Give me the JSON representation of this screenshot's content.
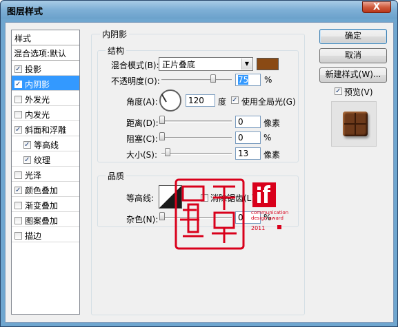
{
  "window": {
    "title": "图层样式",
    "close": "X"
  },
  "stylelist": {
    "header": "样式",
    "blend": "混合选项:默认",
    "items": [
      {
        "label": "投影",
        "checked": true,
        "sub": false,
        "selected": false
      },
      {
        "label": "内阴影",
        "checked": true,
        "sub": false,
        "selected": true
      },
      {
        "label": "外发光",
        "checked": false,
        "sub": false,
        "selected": false
      },
      {
        "label": "内发光",
        "checked": false,
        "sub": false,
        "selected": false
      },
      {
        "label": "斜面和浮雕",
        "checked": true,
        "sub": false,
        "selected": false
      },
      {
        "label": "等高线",
        "checked": true,
        "sub": true,
        "selected": false
      },
      {
        "label": "纹理",
        "checked": true,
        "sub": true,
        "selected": false
      },
      {
        "label": "光泽",
        "checked": false,
        "sub": false,
        "selected": false
      },
      {
        "label": "颜色叠加",
        "checked": true,
        "sub": false,
        "selected": false
      },
      {
        "label": "渐变叠加",
        "checked": false,
        "sub": false,
        "selected": false
      },
      {
        "label": "图案叠加",
        "checked": false,
        "sub": false,
        "selected": false
      },
      {
        "label": "描边",
        "checked": false,
        "sub": false,
        "selected": false
      }
    ]
  },
  "inner_shadow": {
    "group_title": "内阴影",
    "structure": {
      "title": "结构",
      "blend_mode_label": "混合模式(B):",
      "blend_mode_value": "正片叠底",
      "color": "#8a4a14",
      "opacity_label": "不透明度(O):",
      "opacity_value": "75",
      "opacity_unit": "%",
      "opacity_level": 0.75,
      "angle_label": "角度(A):",
      "angle_value": "120",
      "angle_unit": "度",
      "global_light_label": "使用全局光(G)",
      "global_light_checked": true,
      "distance_label": "距离(D):",
      "distance_value": "0",
      "distance_unit": "像素",
      "choke_label": "阻塞(C):",
      "choke_value": "0",
      "choke_unit": "%",
      "size_label": "大小(S):",
      "size_value": "13",
      "size_unit": "像素"
    },
    "quality": {
      "title": "品质",
      "contour_label": "等高线:",
      "antialias_label": "消除锯齿(L)",
      "noise_label": "杂色(N):",
      "noise_value": "0",
      "noise_unit": "%"
    }
  },
  "buttons": {
    "ok": "确定",
    "cancel": "取消",
    "new_style": "新建样式(W)...",
    "preview_label": "预览(V)",
    "preview_checked": true
  },
  "watermark": {
    "award_text": "communication design award",
    "year": "2011",
    "accent": "#d9001b"
  }
}
